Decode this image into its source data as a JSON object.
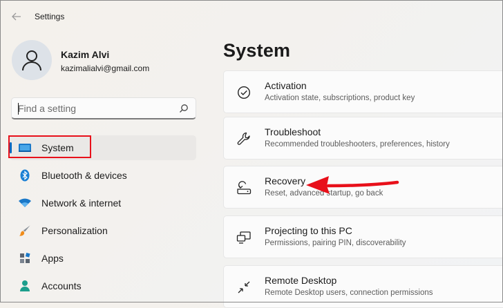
{
  "window": {
    "title": "Settings"
  },
  "profile": {
    "name": "Kazim Alvi",
    "email": "kazimalialvi@gmail.com"
  },
  "search": {
    "placeholder": "Find a setting"
  },
  "nav": {
    "items": [
      {
        "label": "System",
        "icon": "laptop-icon",
        "selected": true
      },
      {
        "label": "Bluetooth & devices",
        "icon": "bluetooth-icon"
      },
      {
        "label": "Network & internet",
        "icon": "wifi-icon"
      },
      {
        "label": "Personalization",
        "icon": "paintbrush-icon"
      },
      {
        "label": "Apps",
        "icon": "apps-icon"
      },
      {
        "label": "Accounts",
        "icon": "person-icon"
      }
    ]
  },
  "main": {
    "title": "System",
    "cards": [
      {
        "title": "Activation",
        "subtitle": "Activation state, subscriptions, product key",
        "icon": "check-circle-icon"
      },
      {
        "title": "Troubleshoot",
        "subtitle": "Recommended troubleshooters, preferences, history",
        "icon": "wrench-icon"
      },
      {
        "title": "Recovery",
        "subtitle": "Reset, advanced startup, go back",
        "icon": "recovery-icon"
      },
      {
        "title": "Projecting to this PC",
        "subtitle": "Permissions, pairing PIN, discoverability",
        "icon": "projector-icon"
      },
      {
        "title": "Remote Desktop",
        "subtitle": "Remote Desktop users, connection permissions",
        "icon": "remote-desktop-icon"
      }
    ]
  },
  "colors": {
    "accent": "#0067c0",
    "annotation": "#e8101a"
  }
}
